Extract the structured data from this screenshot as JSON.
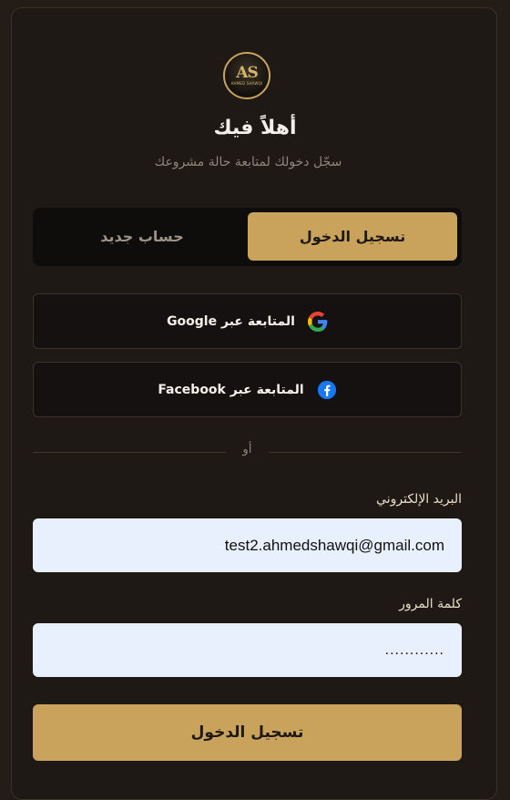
{
  "header": {
    "logo_text": "AS",
    "logo_subtext": "AHMED SHAWQI",
    "title": "أهلاً فيك",
    "subtitle": "سجّل دخولك لمتابعة حالة مشروعك"
  },
  "tabs": {
    "login": "تسجيل الدخول",
    "register": "حساب جديد",
    "active": "login"
  },
  "social": {
    "google_label": "المتابعة عبر Google",
    "facebook_label": "المتابعة عبر Facebook"
  },
  "divider": "أو",
  "form": {
    "email_label": "البريد الإلكتروني",
    "email_value": "test2.ahmedshawqi@gmail.com",
    "password_label": "كلمة المرور",
    "password_value": "............",
    "submit_label": "تسجيل الدخول"
  },
  "colors": {
    "accent": "#c9a35c",
    "background": "#231c17",
    "card": "#1e1915",
    "input_bg": "#e8f0fe"
  }
}
